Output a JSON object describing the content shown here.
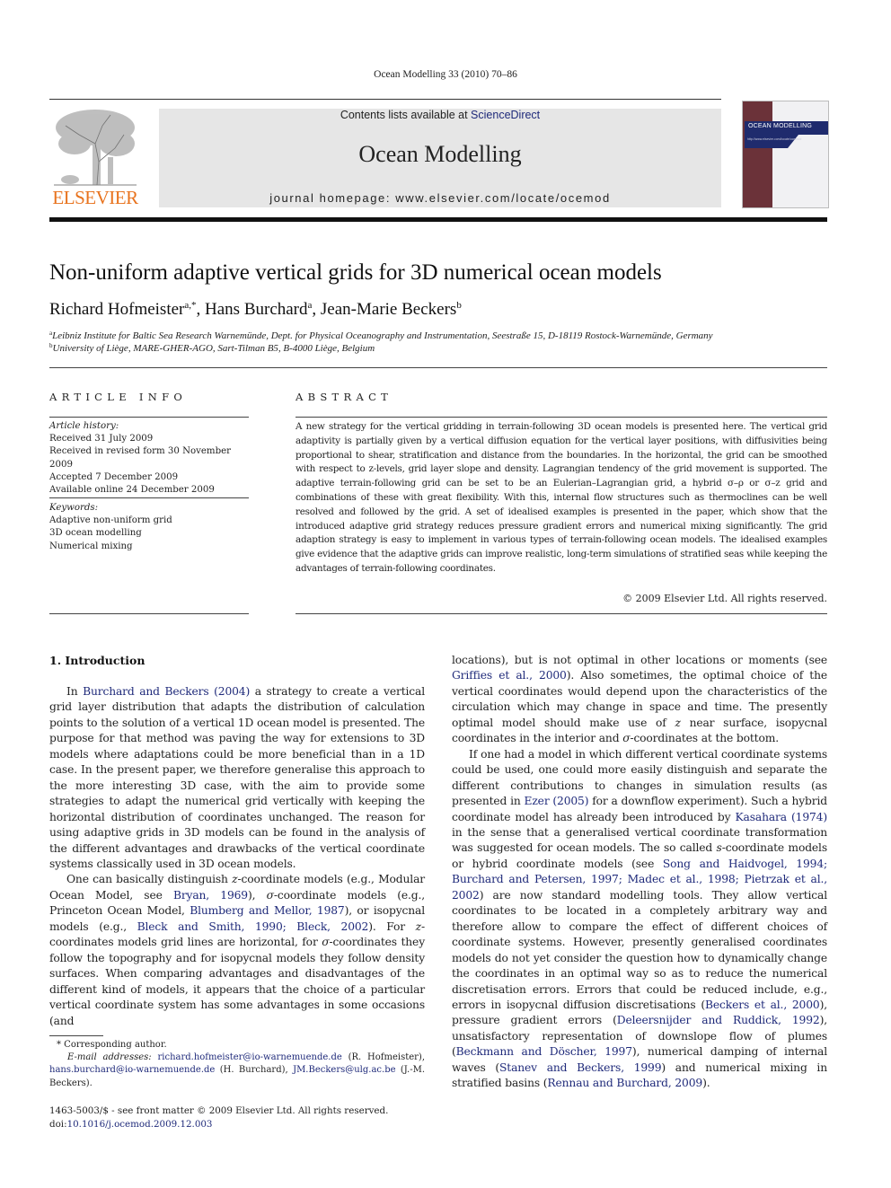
{
  "running_head": "Ocean Modelling 33 (2010) 70–86",
  "banner": {
    "contents_prefix": "Contents lists available at ",
    "contents_link": "ScienceDirect",
    "journal_title": "Ocean Modelling",
    "homepage": "journal homepage: www.elsevier.com/locate/ocemod"
  },
  "publisher_logo": "ELSEVIER",
  "cover": {
    "title": "OCEAN MODELLING",
    "url_line": "http://www.elsevier.com/locate/ocemod"
  },
  "colors": {
    "link": "#1f2a7a",
    "elsevier_orange": "#e8731e",
    "banner_bg": "#e6e6e6",
    "cover_maroon": "#6b3239",
    "cover_blue": "#1f2b6d"
  },
  "article": {
    "title": "Non-uniform adaptive vertical grids for 3D numerical ocean models",
    "authors": [
      {
        "name": "Richard Hofmeister",
        "sup": "a,*",
        "sep": ", "
      },
      {
        "name": "Hans Burchard",
        "sup": "a",
        "sep": ", "
      },
      {
        "name": "Jean-Marie Beckers",
        "sup": "b",
        "sep": ""
      }
    ],
    "affiliations": [
      {
        "key": "a",
        "text": "Leibniz Institute for Baltic Sea Research Warnemünde, Dept. for Physical Oceanography and Instrumentation, Seestraße 15, D-18119 Rostock-Warnemünde, Germany"
      },
      {
        "key": "b",
        "text": "University of Liège, MARE-GHER-AGO, Sart-Tilman B5, B-4000 Liège, Belgium"
      }
    ]
  },
  "article_info": {
    "heading": "ARTICLE INFO",
    "history_label": "Article history:",
    "history": [
      "Received 31 July 2009",
      "Received in revised form 30 November 2009",
      "Accepted 7 December 2009",
      "Available online 24 December 2009"
    ],
    "keywords_label": "Keywords:",
    "keywords": [
      "Adaptive non-uniform grid",
      "3D ocean modelling",
      "Numerical mixing"
    ]
  },
  "abstract": {
    "heading": "ABSTRACT",
    "text": "A new strategy for the vertical gridding in terrain-following 3D ocean models is presented here. The vertical grid adaptivity is partially given by a vertical diffusion equation for the vertical layer positions, with diffusivities being proportional to shear, stratification and distance from the boundaries. In the horizontal, the grid can be smoothed with respect to z-levels, grid layer slope and density. Lagrangian tendency of the grid movement is supported. The adaptive terrain-following grid can be set to be an Eulerian–Lagrangian grid, a hybrid σ–ρ or σ–z grid and combinations of these with great flexibility. With this, internal flow structures such as thermoclines can be well resolved and followed by the grid. A set of idealised examples is presented in the paper, which show that the introduced adaptive grid strategy reduces pressure gradient errors and numerical mixing significantly. The grid adaption strategy is easy to implement in various types of terrain-following ocean models. The idealised examples give evidence that the adaptive grids can improve realistic, long-term simulations of stratified seas while keeping the advantages of terrain-following coordinates.",
    "copyright": "© 2009 Elsevier Ltd. All rights reserved."
  },
  "section1": {
    "heading": "1. Introduction",
    "paragraphs_left": [
      [
        {
          "t": "In "
        },
        {
          "link": "Burchard and Beckers (2004)"
        },
        {
          "t": " a strategy to create a vertical grid layer distribution that adapts the distribution of calculation points to the solution of a vertical 1D ocean model is presented. The purpose for that method was paving the way for extensions to 3D models where adaptations could be more beneficial than in a 1D case. In the present paper, we therefore generalise this approach to the more interesting 3D case, with the aim to provide some strategies to adapt the numerical grid vertically with keeping the horizontal distribution of coordinates unchanged. The reason for using adaptive grids in 3D models can be found in the analysis of the different advantages and drawbacks of the vertical coordinate systems classically used in 3D ocean models."
        }
      ],
      [
        {
          "t": "One can basically distinguish "
        },
        {
          "i": "z"
        },
        {
          "t": "-coordinate models (e.g., Modular Ocean Model, see "
        },
        {
          "link": "Bryan, 1969"
        },
        {
          "t": "), "
        },
        {
          "i": "σ"
        },
        {
          "t": "-coordinate models (e.g., Princeton Ocean Model, "
        },
        {
          "link": "Blumberg and Mellor, 1987"
        },
        {
          "t": "), or isopycnal models (e.g., "
        },
        {
          "link": "Bleck and Smith, 1990; Bleck, 2002"
        },
        {
          "t": "). For "
        },
        {
          "i": "z"
        },
        {
          "t": "-coordinates models grid lines are horizontal, for "
        },
        {
          "i": "σ"
        },
        {
          "t": "-coordinates they follow the topography and for isopycnal models they follow density surfaces. When comparing advantages and disadvantages of the different kind of models, it appears that the choice of a particular vertical coordinate system has some advantages in some occasions (and"
        }
      ]
    ],
    "paragraphs_right": [
      [
        {
          "t": "locations), but is not optimal in other locations or moments (see "
        },
        {
          "link": "Griffies et al., 2000"
        },
        {
          "t": "). Also sometimes, the optimal choice of the vertical coordinates would depend upon the characteristics of the circulation which may change in space and time. The presently optimal model should make use of "
        },
        {
          "i": "z"
        },
        {
          "t": " near surface, isopycnal coordinates in the interior and "
        },
        {
          "i": "σ"
        },
        {
          "t": "-coordinates at the bottom."
        }
      ],
      [
        {
          "t": "If one had a model in which different vertical coordinate systems could be used, one could more easily distinguish and separate the different contributions to changes in simulation results (as presented in "
        },
        {
          "link": "Ezer (2005)"
        },
        {
          "t": " for a downflow experiment). Such a hybrid coordinate model has already been introduced by "
        },
        {
          "link": "Kasahara (1974)"
        },
        {
          "t": " in the sense that a generalised vertical coordinate transformation was suggested for ocean models. The so called "
        },
        {
          "i": "s"
        },
        {
          "t": "-coordinate models or hybrid coordinate models (see "
        },
        {
          "link": "Song and Haidvogel, 1994; Burchard and Petersen, 1997; Madec et al., 1998; Pietrzak et al., 2002"
        },
        {
          "t": ") are now standard modelling tools. They allow vertical coordinates to be located in a completely arbitrary way and therefore allow to compare the effect of different choices of coordinate systems. However, presently generalised coordinates models do not yet consider the question how to dynamically change the coordinates in an optimal way so as to reduce the numerical discretisation errors. Errors that could be reduced include, e.g., errors in isopycnal diffusion discretisations ("
        },
        {
          "link": "Beckers et al., 2000"
        },
        {
          "t": "), pressure gradient errors ("
        },
        {
          "link": "Deleersnijder and Ruddick, 1992"
        },
        {
          "t": "), unsatisfactory representation of downslope flow of plumes ("
        },
        {
          "link": "Beckmann and Döscher, 1997"
        },
        {
          "t": "), numerical damping of internal waves ("
        },
        {
          "link": "Stanev and Beckers, 1999"
        },
        {
          "t": ") and numerical mixing in stratified basins ("
        },
        {
          "link": "Rennau and Burchard, 2009"
        },
        {
          "t": ")."
        }
      ]
    ]
  },
  "footnote": {
    "corresponding": "* Corresponding author.",
    "email_label": "E-mail addresses:",
    "emails": [
      {
        "address": "richard.hofmeister@io-warnemuende.de",
        "who": " (R. Hofmeister), "
      },
      {
        "address": "hans.burchard@io-warnemuende.de",
        "who": " (H. Burchard), "
      },
      {
        "address": "JM.Beckers@ulg.ac.be",
        "who": " (J.-M. Beckers)."
      }
    ]
  },
  "footer": {
    "issn": "1463-5003/$ - see front matter © 2009 Elsevier Ltd. All rights reserved.",
    "doi_prefix": "doi:",
    "doi": "10.1016/j.ocemod.2009.12.003"
  }
}
